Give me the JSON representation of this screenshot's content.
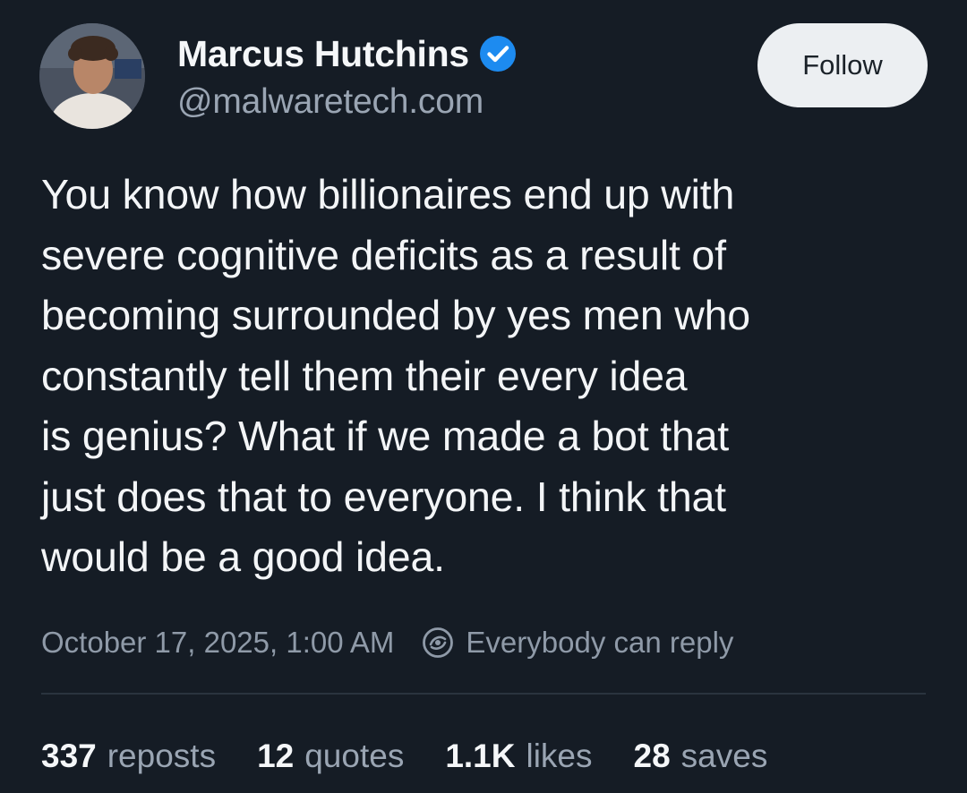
{
  "author": {
    "display_name": "Marcus Hutchins",
    "handle": "@malwaretech.com",
    "verified": true,
    "verified_color": "#1d8bf0"
  },
  "follow_button": {
    "label": "Follow"
  },
  "post": {
    "text_lines": [
      "You know how billionaires end up with",
      "severe cognitive deficits as a result of",
      "becoming surrounded by yes men who",
      "constantly tell them their every idea",
      "is genius? What if we made a bot that",
      "just does that to everyone. I think that",
      "would be a good idea."
    ],
    "timestamp": "October 17, 2025, 1:00 AM",
    "reply_icon": "reply-permission-icon",
    "reply_setting": "Everybody can reply"
  },
  "stats": [
    {
      "count": "337",
      "label": "reposts"
    },
    {
      "count": "12",
      "label": "quotes"
    },
    {
      "count": "1.1K",
      "label": "likes"
    },
    {
      "count": "28",
      "label": "saves"
    }
  ],
  "colors": {
    "background": "#151c25",
    "text_primary": "#f3f5f7",
    "text_secondary": "#9aa5b3",
    "follow_bg": "#eceff2"
  }
}
